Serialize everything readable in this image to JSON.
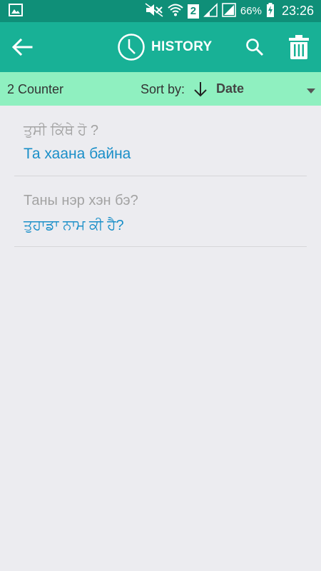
{
  "status_bar": {
    "sim_label": "2",
    "battery_percent": "66%",
    "time": "23:26"
  },
  "app_bar": {
    "title": "HISTORY"
  },
  "sub_bar": {
    "counter": "2 Counter",
    "sort_label": "Sort by:",
    "sort_value": "Date"
  },
  "history": [
    {
      "source": "ਤੁਸੀ ਕਿੱਥੇ ਹੋ ?",
      "translation": "Та хаана байна"
    },
    {
      "source": "Таны нэр хэн бэ?",
      "translation": "ਤੁਹਾਡਾ ਨਾਮ ਕੀ ਹੈ?"
    }
  ],
  "colors": {
    "status_bar": "#0f8f78",
    "app_bar": "#18b196",
    "sub_bar": "#8ff0c0",
    "background": "#ececf0",
    "source_text": "#a3a3a3",
    "translation_text": "#1a8fc8"
  },
  "icons": {
    "status_left": "image-icon",
    "status_right": [
      "mute-icon",
      "wifi-icon",
      "sim-icon",
      "signal-icon",
      "battery-charging-icon"
    ],
    "app_bar": [
      "back-arrow-icon",
      "clock-icon",
      "search-icon",
      "trash-icon"
    ],
    "sub_bar": [
      "sort-down-arrow-icon",
      "dropdown-triangle-icon"
    ]
  }
}
